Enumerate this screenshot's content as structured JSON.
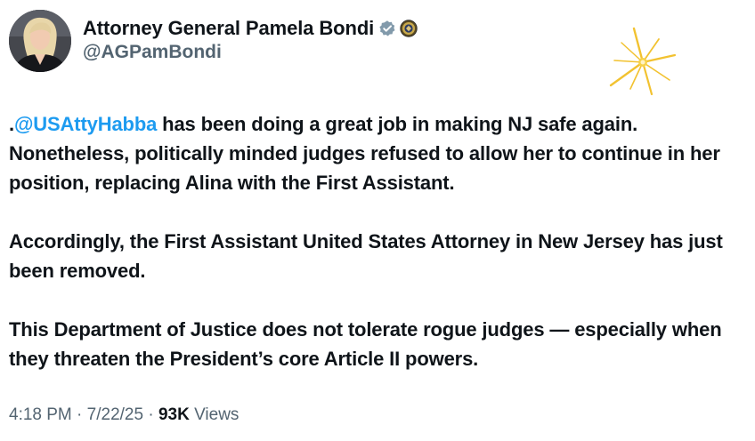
{
  "author": {
    "display_name": "Attorney General Pamela Bondi",
    "handle": "@AGPamBondi",
    "verified_badge": "verified-badge-icon",
    "affiliation_badge": "doj-seal-icon"
  },
  "tweet": {
    "paragraph1": {
      "prefix": ".",
      "mention": "@USAttyHabba",
      "text": " has been doing a great job in making NJ safe again. Nonetheless, politically minded judges refused to allow her to continue in her position, replacing Alina with the First Assistant."
    },
    "paragraph2": "Accordingly, the First Assistant United States Attorney in New Jersey has just been removed.",
    "paragraph3": "This Department of Justice does not tolerate rogue judges — especially when they threaten the President’s core Article II powers."
  },
  "meta": {
    "time": "4:18 PM",
    "sep1": " · ",
    "date": "7/22/25",
    "sep2": " · ",
    "views_count": "93K",
    "views_label": " Views"
  },
  "colors": {
    "text": "#0f1419",
    "secondary": "#536471",
    "link": "#1d9bf0",
    "verified": "#829aab",
    "sparkle": "#f2c230"
  }
}
